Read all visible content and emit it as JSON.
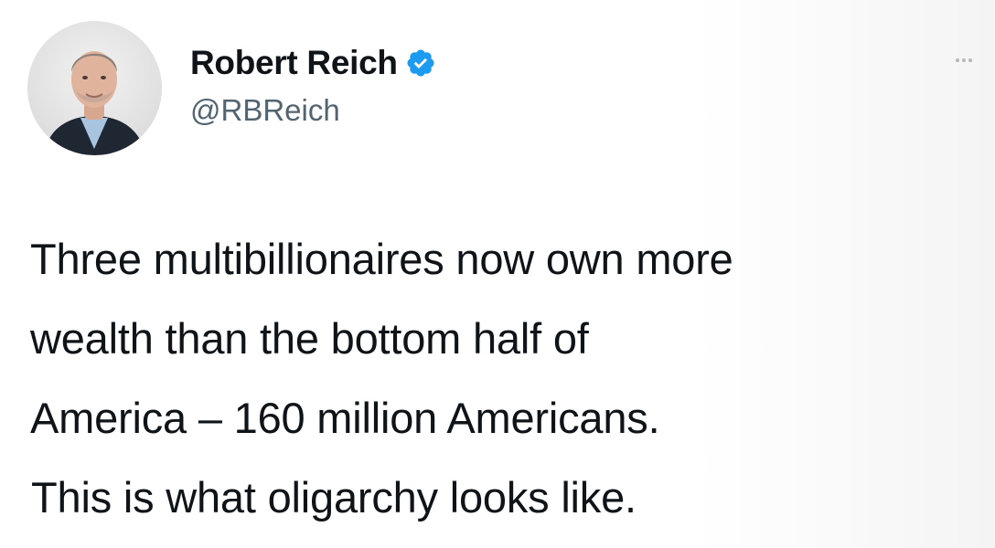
{
  "author": {
    "display_name": "Robert Reich",
    "handle": "@RBReich",
    "verified": true,
    "avatar_icon": "profile-photo",
    "verified_icon": "verified-badge-icon",
    "verified_color": "#1d9bf0"
  },
  "actions": {
    "more_icon": "more-options-icon"
  },
  "tweet": {
    "lines": [
      "Three multibillionaires now own more",
      "wealth than the bottom half of",
      "America – 160 million Americans."
    ],
    "closing": "This is what oligarchy looks like."
  }
}
